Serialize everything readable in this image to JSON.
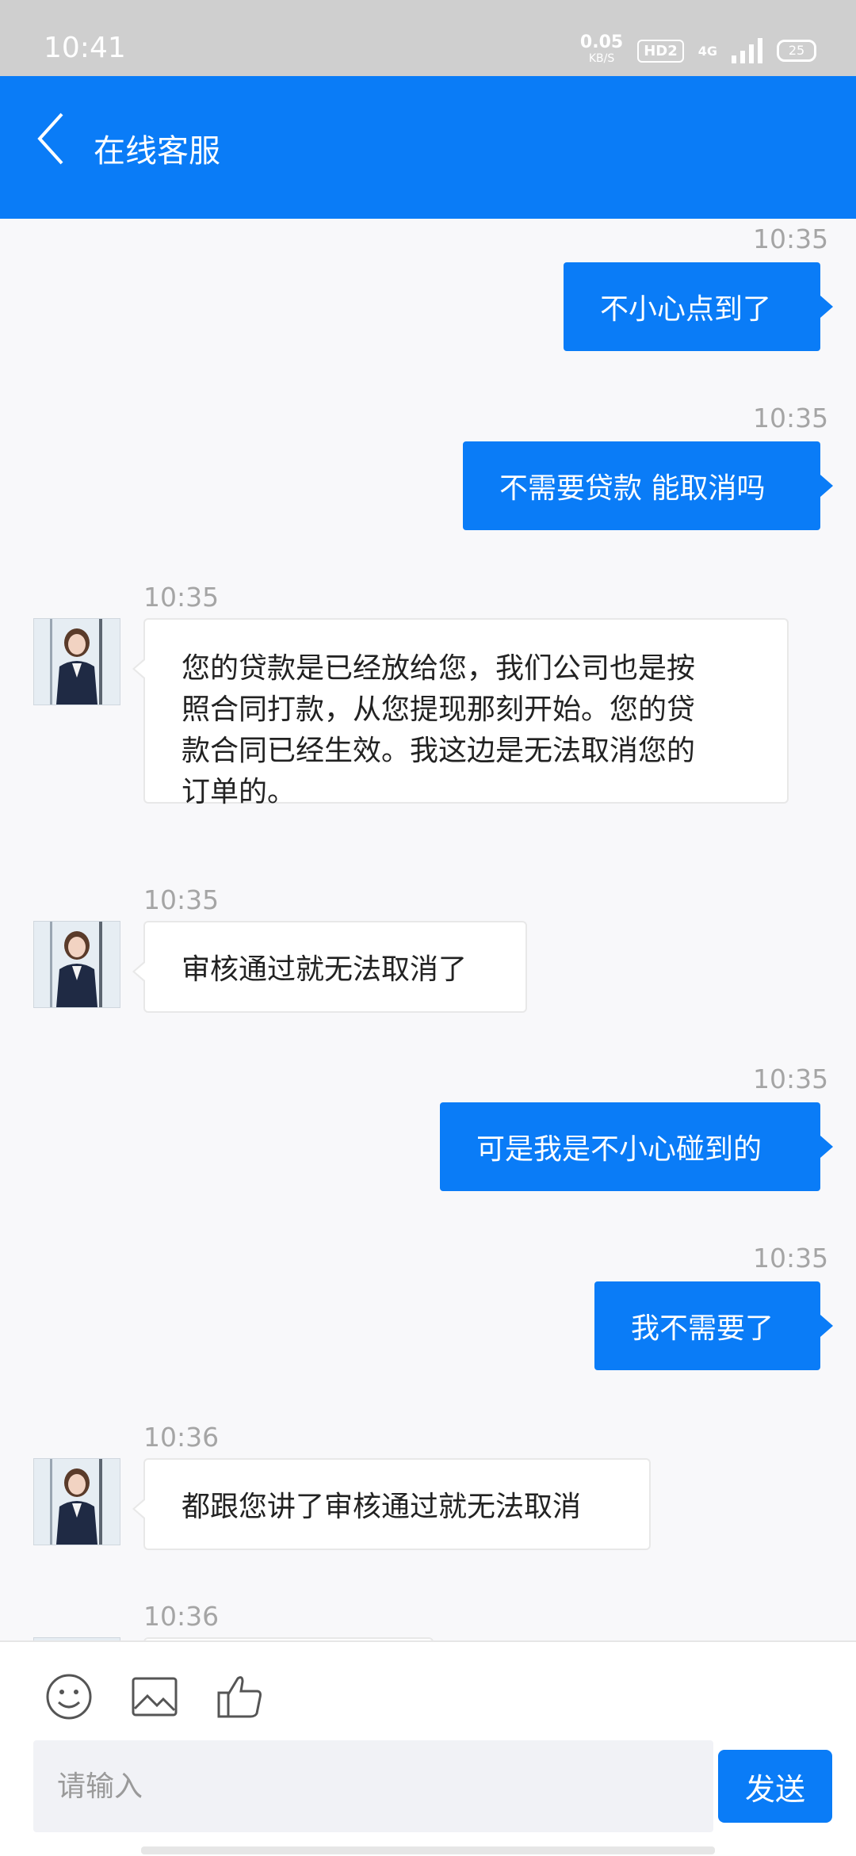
{
  "status_bar": {
    "time": "10:41",
    "net_speed": "0.05",
    "net_unit": "KB/S",
    "hd": "HD2",
    "network": "4G",
    "battery": "25"
  },
  "header": {
    "title": "在线客服"
  },
  "messages": [
    {
      "side": "out",
      "time": "10:35",
      "text": "不小心点到了"
    },
    {
      "side": "out",
      "time": "10:35",
      "text": "不需要贷款 能取消吗"
    },
    {
      "side": "in",
      "time": "10:35",
      "lines": [
        "您的贷款是已经放给您，我们公司也是按",
        "照合同打款，从您提现那刻开始。您的贷",
        "款合同已经生效。我这边是无法取消您的",
        "订单的。"
      ]
    },
    {
      "side": "in",
      "time": "10:35",
      "text": "审核通过就无法取消了"
    },
    {
      "side": "out",
      "time": "10:35",
      "text": "可是我是不小心碰到的"
    },
    {
      "side": "out",
      "time": "10:35",
      "text": "我不需要了"
    },
    {
      "side": "in",
      "time": "10:36",
      "text": "都跟您讲了审核通过就无法取消"
    },
    {
      "side": "in",
      "time": "10:36",
      "text": ""
    }
  ],
  "composer": {
    "placeholder": "请输入",
    "send_label": "发送",
    "icons": [
      "emoji-icon",
      "image-icon",
      "thumbs-up-icon"
    ]
  },
  "colors": {
    "brand": "#0a7cf7",
    "background": "#f8f8fa",
    "timestamp": "#a5a5a5"
  }
}
